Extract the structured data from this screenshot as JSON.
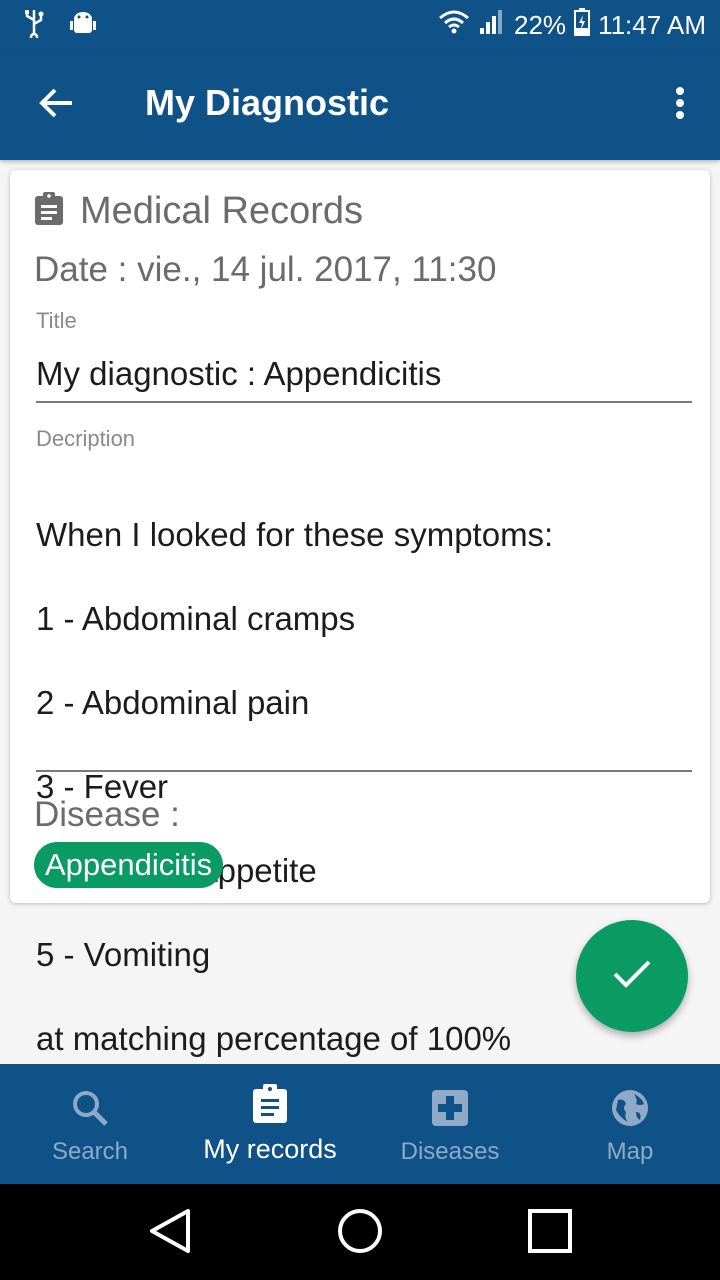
{
  "status_bar": {
    "battery": "22%",
    "time": "11:47 AM",
    "icons": [
      "usb-icon",
      "android-debug-icon",
      "wifi-icon",
      "signal-icon",
      "battery-charging-icon"
    ]
  },
  "app_bar": {
    "title": "My Diagnostic",
    "back_icon": "arrow-back-icon",
    "menu_icon": "more-vert-icon"
  },
  "card": {
    "header_icon": "clipboard-icon",
    "title": "Medical Records",
    "date": "Date : vie., 14 jul. 2017, 11:30",
    "title_field": {
      "label": "Title",
      "value": "My diagnostic : Appendicitis"
    },
    "description_field": {
      "label": "Decription",
      "lines": [
        "When I looked for these symptoms:",
        "1 - Abdominal cramps",
        "2 - Abdominal pain",
        "3 - Fever",
        "4 - Lack of appetite",
        "5 - Vomiting",
        "at matching percentage of 100%"
      ]
    },
    "disease_label": "Disease :",
    "disease_chip": "Appendicitis"
  },
  "fab": {
    "icon": "check-icon"
  },
  "bottom_nav": {
    "items": [
      {
        "label": "Search",
        "icon": "search-icon",
        "active": false
      },
      {
        "label": "My records",
        "icon": "clipboard-icon",
        "active": true
      },
      {
        "label": "Diseases",
        "icon": "medical-cross-icon",
        "active": false
      },
      {
        "label": "Map",
        "icon": "globe-icon",
        "active": false
      }
    ]
  },
  "colors": {
    "primary": "#0f5288",
    "accent": "#0a9b64",
    "inactive_nav": "#8fa9c7"
  }
}
